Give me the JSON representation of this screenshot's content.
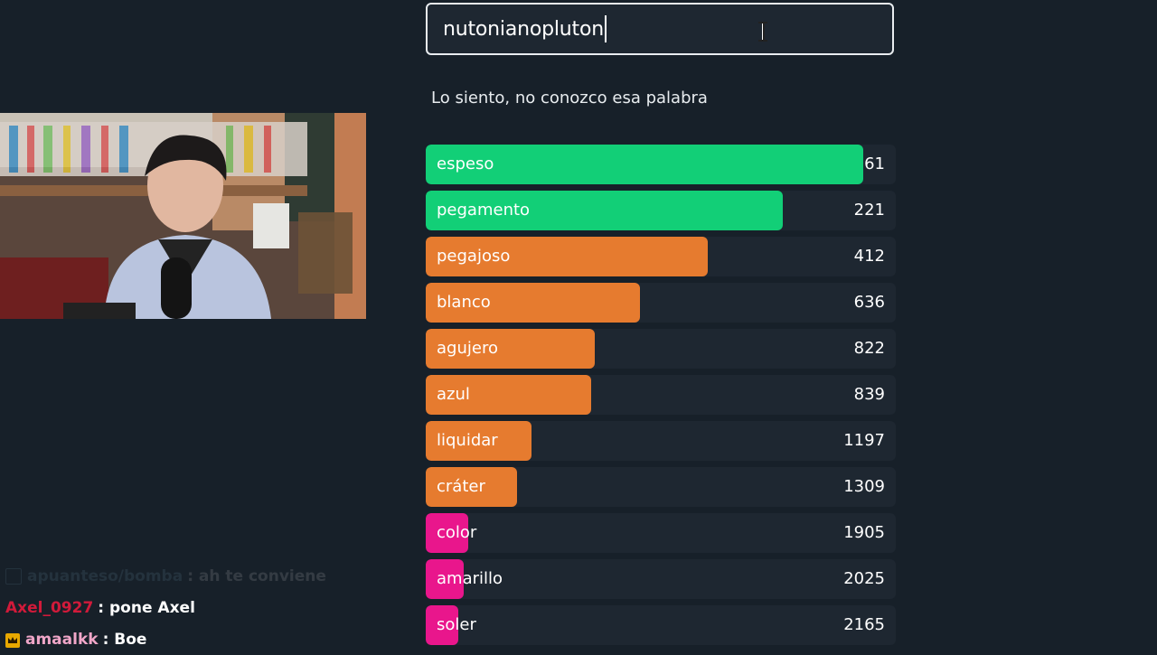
{
  "search": {
    "value": "nutonianopluton"
  },
  "message": "Lo siento, no conozco esa palabra",
  "guesses": [
    {
      "word": "espeso",
      "rank": "61",
      "color": "#12cf77",
      "fill": 0.93
    },
    {
      "word": "pegamento",
      "rank": "221",
      "color": "#12cf77",
      "fill": 0.76
    },
    {
      "word": "pegajoso",
      "rank": "412",
      "color": "#e67b2f",
      "fill": 0.6
    },
    {
      "word": "blanco",
      "rank": "636",
      "color": "#e67b2f",
      "fill": 0.455
    },
    {
      "word": "agujero",
      "rank": "822",
      "color": "#e67b2f",
      "fill": 0.36
    },
    {
      "word": "azul",
      "rank": "839",
      "color": "#e67b2f",
      "fill": 0.352
    },
    {
      "word": "liquidar",
      "rank": "1197",
      "color": "#e67b2f",
      "fill": 0.225
    },
    {
      "word": "cráter",
      "rank": "1309",
      "color": "#e67b2f",
      "fill": 0.195
    },
    {
      "word": "color",
      "rank": "1905",
      "color": "#e9168c",
      "fill": 0.09
    },
    {
      "word": "amarillo",
      "rank": "2025",
      "color": "#e9168c",
      "fill": 0.08
    },
    {
      "word": "soler",
      "rank": "2165",
      "color": "#e9168c",
      "fill": 0.07
    }
  ],
  "chat": [
    {
      "user": "apuanteso/bomba",
      "text": ": ah te conviene",
      "user_color": "#7fb0c9",
      "badge": "",
      "faded": true
    },
    {
      "user": "Axel_0927",
      "text": ": pone Axel",
      "user_color": "#d11a3a",
      "badge": "",
      "faded": false
    },
    {
      "user": "amaalkk",
      "text": ": Boe",
      "user_color": "#f0a6c8",
      "badge": "crown-icon",
      "faded": false
    }
  ]
}
